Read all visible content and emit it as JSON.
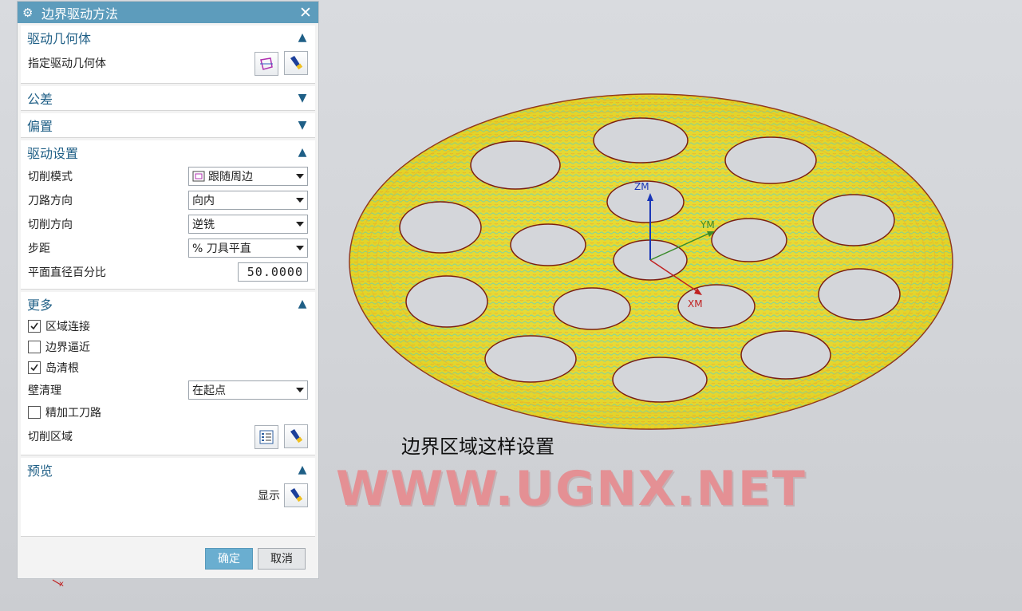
{
  "dialog": {
    "title": "边界驱动方法",
    "close_glyph": "✕",
    "sections": {
      "drive_geometry": {
        "title": "驱动几何体",
        "specify_label": "指定驱动几何体"
      },
      "tolerance": {
        "title": "公差"
      },
      "offset": {
        "title": "偏置"
      },
      "drive_settings": {
        "title": "驱动设置",
        "cut_pattern": {
          "label": "切削模式",
          "value": "跟随周边"
        },
        "path_direction": {
          "label": "刀路方向",
          "value": "向内"
        },
        "cut_direction": {
          "label": "切削方向",
          "value": "逆铣"
        },
        "stepover": {
          "label": "步距",
          "value": "% 刀具平直"
        },
        "percent_flat_diameter": {
          "label": "平面直径百分比",
          "value": "50.0000"
        }
      },
      "more": {
        "title": "更多",
        "region_connect": {
          "label": "区域连接",
          "checked": true
        },
        "boundary_approach": {
          "label": "边界逼近",
          "checked": false
        },
        "island_cleanup": {
          "label": "岛清根",
          "checked": true
        },
        "wall_cleanup": {
          "label": "壁清理",
          "value": "在起点"
        },
        "finish_passes": {
          "label": "精加工刀路",
          "checked": false
        },
        "cut_region_label": "切削区域"
      },
      "preview": {
        "title": "预览",
        "display_label": "显示"
      }
    },
    "buttons": {
      "ok": "确定",
      "cancel": "取消"
    }
  },
  "viewport": {
    "axes": {
      "zm": "ZM",
      "ym": "YM",
      "xm": "XM"
    },
    "caption": "边界区域这样设置",
    "watermark": "WWW.UGNX.NET",
    "colors": {
      "toolpath_yellow": "#e8dc2a",
      "toolpath_green": "#5fd0a0",
      "rim": "#8a2a18",
      "hole_fill": "#d4d6da"
    }
  }
}
